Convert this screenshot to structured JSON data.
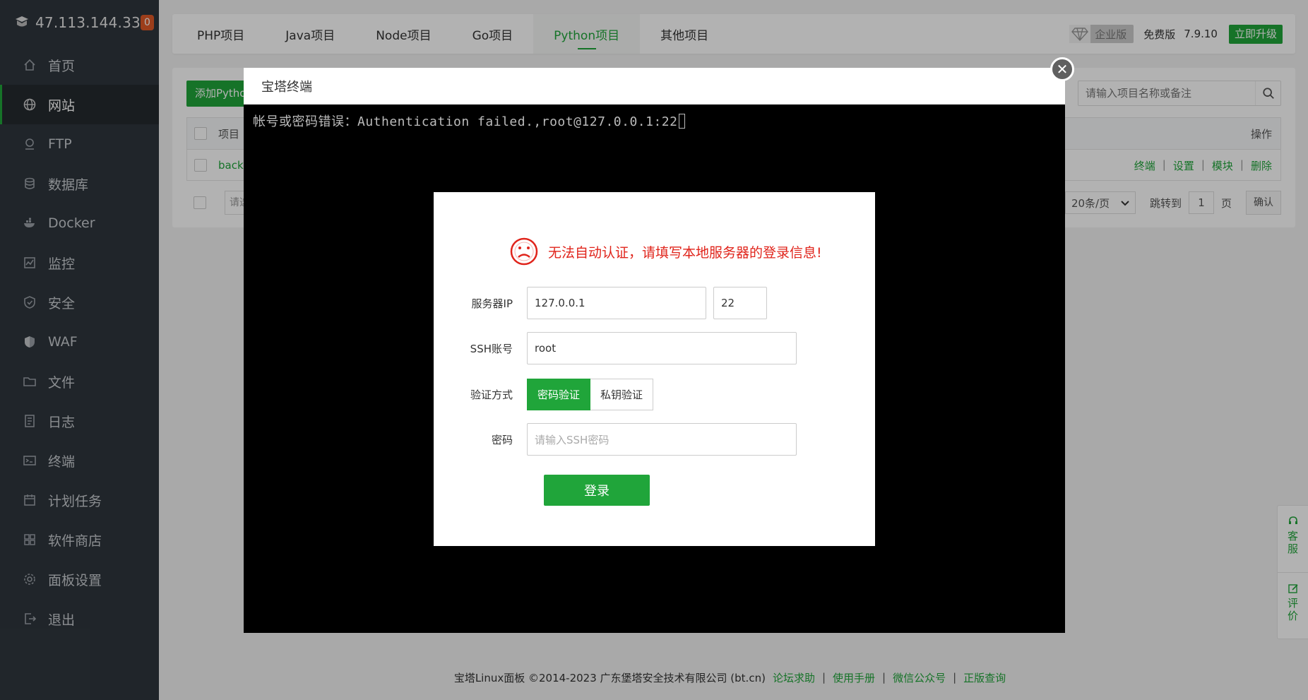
{
  "sidebar": {
    "ip": "47.113.144.33",
    "badge": "0",
    "items": [
      {
        "label": "首页",
        "icon": "home-icon"
      },
      {
        "label": "网站",
        "icon": "globe-icon"
      },
      {
        "label": "FTP",
        "icon": "ftp-icon"
      },
      {
        "label": "数据库",
        "icon": "database-icon"
      },
      {
        "label": "Docker",
        "icon": "docker-icon"
      },
      {
        "label": "监控",
        "icon": "monitor-icon"
      },
      {
        "label": "安全",
        "icon": "shield-icon"
      },
      {
        "label": "WAF",
        "icon": "waf-icon"
      },
      {
        "label": "文件",
        "icon": "folder-icon"
      },
      {
        "label": "日志",
        "icon": "log-icon"
      },
      {
        "label": "终端",
        "icon": "terminal-icon"
      },
      {
        "label": "计划任务",
        "icon": "calendar-icon"
      },
      {
        "label": "软件商店",
        "icon": "apps-icon"
      },
      {
        "label": "面板设置",
        "icon": "gear-icon"
      },
      {
        "label": "退出",
        "icon": "logout-icon"
      }
    ],
    "active_index": 1
  },
  "tabs": [
    "PHP项目",
    "Java项目",
    "Node项目",
    "Go项目",
    "Python项目",
    "其他项目"
  ],
  "active_tab": 4,
  "topright": {
    "enterprise": "企业版",
    "free": "免费版",
    "version": "7.9.10",
    "upgrade": "立即升级"
  },
  "panel": {
    "add_button": "添加Pytho",
    "search_placeholder": "请输入项目名称或备注",
    "col_name": "项目",
    "col_ops": "操作",
    "row_name": "back",
    "row_ops": [
      "终端",
      "设置",
      "模块",
      "删除"
    ],
    "batch_placeholder": "请选",
    "per_page": "20条/页",
    "jump_to": "跳转到",
    "page_num": "1",
    "page_unit": "页",
    "confirm": "确认"
  },
  "terminal": {
    "title": "宝塔终端",
    "output": "帐号或密码错误：Authentication failed.,root@127.0.0.1:22"
  },
  "login": {
    "message": "无法自动认证，请填写本地服务器的登录信息!",
    "ip_label": "服务器IP",
    "ip_value": "127.0.0.1",
    "port_value": "22",
    "ssh_label": "SSH账号",
    "ssh_value": "root",
    "auth_label": "验证方式",
    "auth_password": "密码验证",
    "auth_key": "私钥验证",
    "pwd_label": "密码",
    "pwd_placeholder": "请输入SSH密码",
    "login_button": "登录"
  },
  "float": {
    "service": [
      "客",
      "服"
    ],
    "review": [
      "评",
      "价"
    ]
  },
  "footer": {
    "copyright": "宝塔Linux面板 ©2014-2023 广东堡塔安全技术有限公司 (bt.cn)",
    "links": [
      "论坛求助",
      "使用手册",
      "微信公众号",
      "正版查询"
    ]
  },
  "colors": {
    "accent": "#20a53a",
    "sidebar": "#2f363d",
    "error": "#e0241b"
  }
}
